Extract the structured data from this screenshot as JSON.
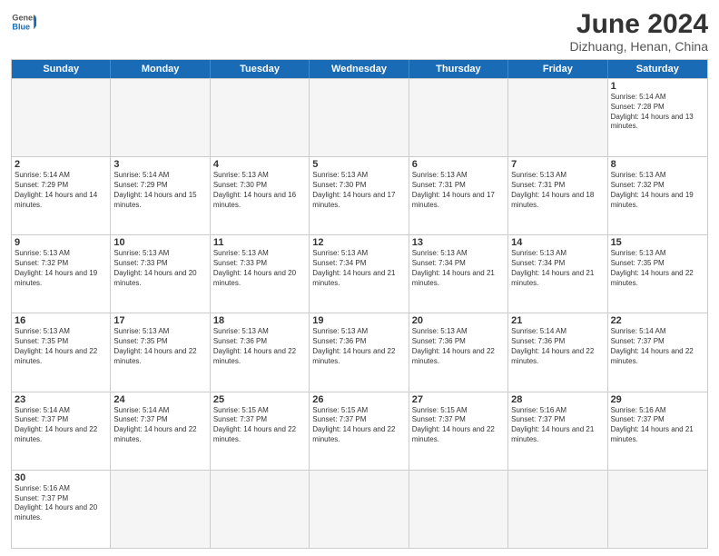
{
  "header": {
    "logo_general": "General",
    "logo_blue": "Blue",
    "month_title": "June 2024",
    "location": "Dizhuang, Henan, China"
  },
  "weekdays": [
    "Sunday",
    "Monday",
    "Tuesday",
    "Wednesday",
    "Thursday",
    "Friday",
    "Saturday"
  ],
  "weeks": [
    [
      {
        "day": "",
        "sunrise": "",
        "sunset": "",
        "daylight": "",
        "empty": true
      },
      {
        "day": "",
        "sunrise": "",
        "sunset": "",
        "daylight": "",
        "empty": true
      },
      {
        "day": "",
        "sunrise": "",
        "sunset": "",
        "daylight": "",
        "empty": true
      },
      {
        "day": "",
        "sunrise": "",
        "sunset": "",
        "daylight": "",
        "empty": true
      },
      {
        "day": "",
        "sunrise": "",
        "sunset": "",
        "daylight": "",
        "empty": true
      },
      {
        "day": "",
        "sunrise": "",
        "sunset": "",
        "daylight": "",
        "empty": true
      },
      {
        "day": "1",
        "sunrise": "Sunrise: 5:14 AM",
        "sunset": "Sunset: 7:28 PM",
        "daylight": "Daylight: 14 hours and 13 minutes.",
        "empty": false
      }
    ],
    [
      {
        "day": "2",
        "sunrise": "Sunrise: 5:14 AM",
        "sunset": "Sunset: 7:29 PM",
        "daylight": "Daylight: 14 hours and 14 minutes.",
        "empty": false
      },
      {
        "day": "3",
        "sunrise": "Sunrise: 5:14 AM",
        "sunset": "Sunset: 7:29 PM",
        "daylight": "Daylight: 14 hours and 15 minutes.",
        "empty": false
      },
      {
        "day": "4",
        "sunrise": "Sunrise: 5:13 AM",
        "sunset": "Sunset: 7:30 PM",
        "daylight": "Daylight: 14 hours and 16 minutes.",
        "empty": false
      },
      {
        "day": "5",
        "sunrise": "Sunrise: 5:13 AM",
        "sunset": "Sunset: 7:30 PM",
        "daylight": "Daylight: 14 hours and 17 minutes.",
        "empty": false
      },
      {
        "day": "6",
        "sunrise": "Sunrise: 5:13 AM",
        "sunset": "Sunset: 7:31 PM",
        "daylight": "Daylight: 14 hours and 17 minutes.",
        "empty": false
      },
      {
        "day": "7",
        "sunrise": "Sunrise: 5:13 AM",
        "sunset": "Sunset: 7:31 PM",
        "daylight": "Daylight: 14 hours and 18 minutes.",
        "empty": false
      },
      {
        "day": "8",
        "sunrise": "Sunrise: 5:13 AM",
        "sunset": "Sunset: 7:32 PM",
        "daylight": "Daylight: 14 hours and 19 minutes.",
        "empty": false
      }
    ],
    [
      {
        "day": "9",
        "sunrise": "Sunrise: 5:13 AM",
        "sunset": "Sunset: 7:32 PM",
        "daylight": "Daylight: 14 hours and 19 minutes.",
        "empty": false
      },
      {
        "day": "10",
        "sunrise": "Sunrise: 5:13 AM",
        "sunset": "Sunset: 7:33 PM",
        "daylight": "Daylight: 14 hours and 20 minutes.",
        "empty": false
      },
      {
        "day": "11",
        "sunrise": "Sunrise: 5:13 AM",
        "sunset": "Sunset: 7:33 PM",
        "daylight": "Daylight: 14 hours and 20 minutes.",
        "empty": false
      },
      {
        "day": "12",
        "sunrise": "Sunrise: 5:13 AM",
        "sunset": "Sunset: 7:34 PM",
        "daylight": "Daylight: 14 hours and 21 minutes.",
        "empty": false
      },
      {
        "day": "13",
        "sunrise": "Sunrise: 5:13 AM",
        "sunset": "Sunset: 7:34 PM",
        "daylight": "Daylight: 14 hours and 21 minutes.",
        "empty": false
      },
      {
        "day": "14",
        "sunrise": "Sunrise: 5:13 AM",
        "sunset": "Sunset: 7:34 PM",
        "daylight": "Daylight: 14 hours and 21 minutes.",
        "empty": false
      },
      {
        "day": "15",
        "sunrise": "Sunrise: 5:13 AM",
        "sunset": "Sunset: 7:35 PM",
        "daylight": "Daylight: 14 hours and 22 minutes.",
        "empty": false
      }
    ],
    [
      {
        "day": "16",
        "sunrise": "Sunrise: 5:13 AM",
        "sunset": "Sunset: 7:35 PM",
        "daylight": "Daylight: 14 hours and 22 minutes.",
        "empty": false
      },
      {
        "day": "17",
        "sunrise": "Sunrise: 5:13 AM",
        "sunset": "Sunset: 7:35 PM",
        "daylight": "Daylight: 14 hours and 22 minutes.",
        "empty": false
      },
      {
        "day": "18",
        "sunrise": "Sunrise: 5:13 AM",
        "sunset": "Sunset: 7:36 PM",
        "daylight": "Daylight: 14 hours and 22 minutes.",
        "empty": false
      },
      {
        "day": "19",
        "sunrise": "Sunrise: 5:13 AM",
        "sunset": "Sunset: 7:36 PM",
        "daylight": "Daylight: 14 hours and 22 minutes.",
        "empty": false
      },
      {
        "day": "20",
        "sunrise": "Sunrise: 5:13 AM",
        "sunset": "Sunset: 7:36 PM",
        "daylight": "Daylight: 14 hours and 22 minutes.",
        "empty": false
      },
      {
        "day": "21",
        "sunrise": "Sunrise: 5:14 AM",
        "sunset": "Sunset: 7:36 PM",
        "daylight": "Daylight: 14 hours and 22 minutes.",
        "empty": false
      },
      {
        "day": "22",
        "sunrise": "Sunrise: 5:14 AM",
        "sunset": "Sunset: 7:37 PM",
        "daylight": "Daylight: 14 hours and 22 minutes.",
        "empty": false
      }
    ],
    [
      {
        "day": "23",
        "sunrise": "Sunrise: 5:14 AM",
        "sunset": "Sunset: 7:37 PM",
        "daylight": "Daylight: 14 hours and 22 minutes.",
        "empty": false
      },
      {
        "day": "24",
        "sunrise": "Sunrise: 5:14 AM",
        "sunset": "Sunset: 7:37 PM",
        "daylight": "Daylight: 14 hours and 22 minutes.",
        "empty": false
      },
      {
        "day": "25",
        "sunrise": "Sunrise: 5:15 AM",
        "sunset": "Sunset: 7:37 PM",
        "daylight": "Daylight: 14 hours and 22 minutes.",
        "empty": false
      },
      {
        "day": "26",
        "sunrise": "Sunrise: 5:15 AM",
        "sunset": "Sunset: 7:37 PM",
        "daylight": "Daylight: 14 hours and 22 minutes.",
        "empty": false
      },
      {
        "day": "27",
        "sunrise": "Sunrise: 5:15 AM",
        "sunset": "Sunset: 7:37 PM",
        "daylight": "Daylight: 14 hours and 22 minutes.",
        "empty": false
      },
      {
        "day": "28",
        "sunrise": "Sunrise: 5:16 AM",
        "sunset": "Sunset: 7:37 PM",
        "daylight": "Daylight: 14 hours and 21 minutes.",
        "empty": false
      },
      {
        "day": "29",
        "sunrise": "Sunrise: 5:16 AM",
        "sunset": "Sunset: 7:37 PM",
        "daylight": "Daylight: 14 hours and 21 minutes.",
        "empty": false
      }
    ],
    [
      {
        "day": "30",
        "sunrise": "Sunrise: 5:16 AM",
        "sunset": "Sunset: 7:37 PM",
        "daylight": "Daylight: 14 hours and 20 minutes.",
        "empty": false
      },
      {
        "day": "",
        "sunrise": "",
        "sunset": "",
        "daylight": "",
        "empty": true
      },
      {
        "day": "",
        "sunrise": "",
        "sunset": "",
        "daylight": "",
        "empty": true
      },
      {
        "day": "",
        "sunrise": "",
        "sunset": "",
        "daylight": "",
        "empty": true
      },
      {
        "day": "",
        "sunrise": "",
        "sunset": "",
        "daylight": "",
        "empty": true
      },
      {
        "day": "",
        "sunrise": "",
        "sunset": "",
        "daylight": "",
        "empty": true
      },
      {
        "day": "",
        "sunrise": "",
        "sunset": "",
        "daylight": "",
        "empty": true
      }
    ]
  ]
}
